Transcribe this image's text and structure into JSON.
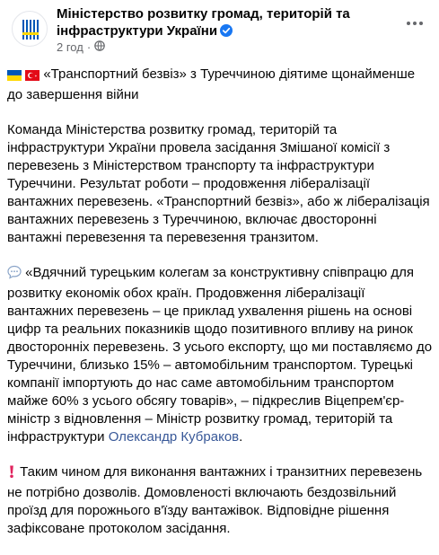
{
  "header": {
    "page_name": "Міністерство розвитку громад, територій та інфраструктури України",
    "timestamp": "2 год",
    "dot": "·",
    "more_icon": "ellipsis-icon",
    "audience_icon": "globe-icon"
  },
  "colors": {
    "link": "#385898",
    "meta": "#65676b",
    "verified": "#1877f2",
    "flag_blue": "#0057b7",
    "flag_yellow": "#ffd700",
    "turkey_red": "#e30a17"
  },
  "post": {
    "title_line": "«Транспортний безвіз» з Туреччиною діятиме щонайменше до завершення війни",
    "para1": "Команда Міністерства розвитку громад, територій та інфраструктури України провела засідання Змішаної комісії з перевезень з Міністерством транспорту та інфраструктури Туреччини. Результат роботи – продовження лібералізації вантажних перевезень. «Транспортний безвіз», або ж лібералізація вантажних перевезень з Туреччиною, включає двосторонні вантажні перевезення та перевезення транзитом.",
    "para2_text": "«Вдячний турецьким колегам за конструктивну співпрацю для розвитку економік обох країн. Продовження лібералізації вантажних перевезень – це приклад ухвалення рішень на основі цифр та реальних показників щодо позитивного впливу на ринок двосторонніх перевезень. З усього експорту, що ми поставляємо до Туреччини, близько 15% – автомобільним транспортом. Турецькі компанії імпортують до нас саме автомобільним транспортом майже 60% з усього обсягу товарів», – підкреслив Віцепрем'єр-міністр з відновлення – Міністр розвитку громад, територій та інфраструктури ",
    "para2_link": "Олександр Кубраков",
    "para2_end": ".",
    "para3": "Таким чином для виконання вантажних і транзитних перевезень не потрібно дозволів. Домовленості включають бездозвільний проїзд для порожнього в'їзду вантажівок. Відповідне рішення зафіксоване протоколом засідання."
  }
}
